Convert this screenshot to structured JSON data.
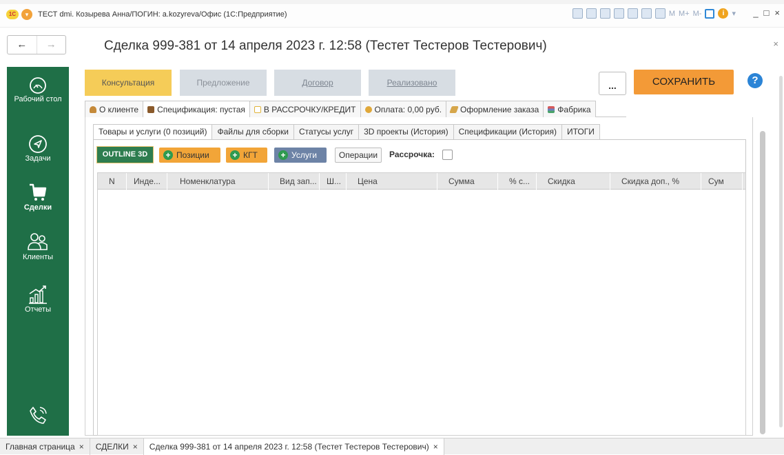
{
  "window": {
    "title": "ТЕСТ dmi. Козырева Анна/ПОГИН: a.kozyreva/Офис (1С:Предприятие)",
    "logo_text": "1С",
    "toolbar_m_labels": [
      "M",
      "M+",
      "M-"
    ],
    "controls": [
      "_",
      "□",
      "×"
    ]
  },
  "header": {
    "back": "←",
    "forward": "→",
    "title": "Сделка 999-381 от 14 апреля 2023 г. 12:58 (Тестет Тестеров Тестерович)",
    "close": "×"
  },
  "sidebar": {
    "items": [
      {
        "label": "Рабочий стол",
        "icon": "speedometer-icon"
      },
      {
        "label": "Задачи",
        "icon": "navigation-arrow-icon"
      },
      {
        "label": "Сделки",
        "icon": "cart-icon",
        "active": true
      },
      {
        "label": "Клиенты",
        "icon": "users-icon"
      },
      {
        "label": "Отчеты",
        "icon": "chart-growth-icon"
      },
      {
        "label": "",
        "icon": "phone-call-icon"
      }
    ]
  },
  "stages": [
    "Консультация",
    "Предложение",
    "Договор",
    "Реализовано"
  ],
  "actions": {
    "more": "...",
    "save": "СОХРАНИТЬ",
    "help": "?"
  },
  "tabs_top": [
    {
      "label": "О клиенте",
      "icon": "person-icon",
      "color": "#c58a3a"
    },
    {
      "label": "Спецификация: пустая",
      "icon": "book-icon",
      "color": "#8a5a2b",
      "active": true
    },
    {
      "label": "В РАССРОЧКУ/КРЕДИТ",
      "icon": "credit-card-icon",
      "color": "#e0b43a"
    },
    {
      "label": "Оплата: 0,00 руб.",
      "icon": "coin-icon",
      "color": "#e0a83a"
    },
    {
      "label": "Оформление заказа",
      "icon": "pencil-icon",
      "color": "#d6a64a"
    },
    {
      "label": "Фабрика",
      "icon": "factory-icon",
      "color": "#6d7fc0"
    }
  ],
  "tabs_inner": [
    {
      "label": "Товары и услуги (0 позиций)",
      "active": true
    },
    {
      "label": "Файлы для сборки"
    },
    {
      "label": "Статусы услуг"
    },
    {
      "label": "3D проекты (История)"
    },
    {
      "label": "Спецификации (История)"
    },
    {
      "label": "ИТОГИ"
    }
  ],
  "toolbar": {
    "outline": "OUTLINE 3D",
    "positions": "Позиции",
    "kgt": "КГТ",
    "services": "Услуги",
    "operations": "Операции",
    "installment_label": "Рассрочка:",
    "installment_checked": false
  },
  "table": {
    "columns": [
      "N",
      "Инде...",
      "Номенклатура",
      "Вид зап...",
      "Ш...",
      "Цена",
      "Сумма",
      "% с...",
      "Скидка",
      "Скидка доп., %",
      "Сум"
    ]
  },
  "taskbar": {
    "tabs": [
      {
        "label": "Главная страница",
        "close": "×"
      },
      {
        "label": "СДЕЛКИ",
        "close": "×"
      },
      {
        "label": "Сделка 999-381 от 14 апреля 2023 г. 12:58 (Тестет Тестеров Тестерович)",
        "close": "×",
        "active": true
      }
    ]
  },
  "colors": {
    "sidebar": "#1f6f47",
    "stage_active": "#f5cc58",
    "stage_inactive": "#d7dde3",
    "save": "#f39a37",
    "help": "#2b84d6",
    "outline_btn": "#2e7d4f",
    "orange_btn": "#f2a538",
    "blue_btn": "#6d83a6"
  }
}
